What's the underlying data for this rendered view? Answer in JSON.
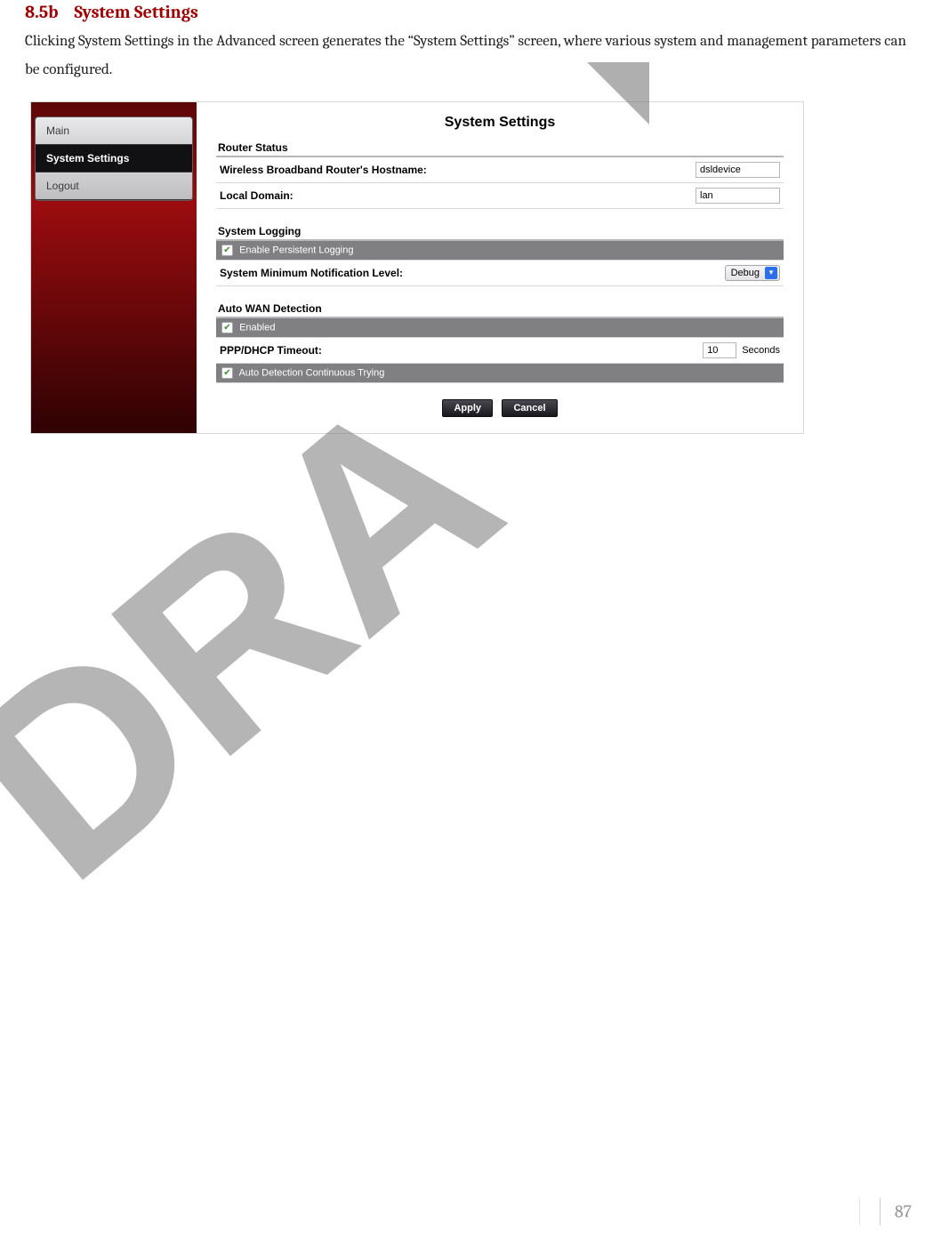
{
  "heading": {
    "num": "8.5b",
    "title": "System Settings"
  },
  "body": "Clicking System Settings in the Advanced screen generates the “System Settings” screen, where various system and management parameters can be configured.",
  "sidebar": {
    "items": [
      {
        "label": "Main"
      },
      {
        "label": "System Settings"
      },
      {
        "label": "Logout"
      }
    ]
  },
  "panel": {
    "title": "System Settings",
    "router_status": {
      "heading": "Router Status",
      "hostname_label": "Wireless Broadband Router's Hostname:",
      "hostname_value": "dsldevice",
      "domain_label": "Local Domain:",
      "domain_value": "lan"
    },
    "logging": {
      "heading": "System Logging",
      "persistent_label": "Enable Persistent Logging",
      "persistent_checked": true,
      "notif_label": "System Minimum Notification Level:",
      "notif_value": "Debug"
    },
    "autowan": {
      "heading": "Auto WAN Detection",
      "enabled_label": "Enabled",
      "enabled_checked": true,
      "timeout_label": "PPP/DHCP Timeout:",
      "timeout_value": "10",
      "timeout_unit": "Seconds",
      "continuous_label": "Auto Detection Continuous Trying",
      "continuous_checked": true
    },
    "buttons": {
      "apply": "Apply",
      "cancel": "Cancel"
    }
  },
  "page_number": "87"
}
